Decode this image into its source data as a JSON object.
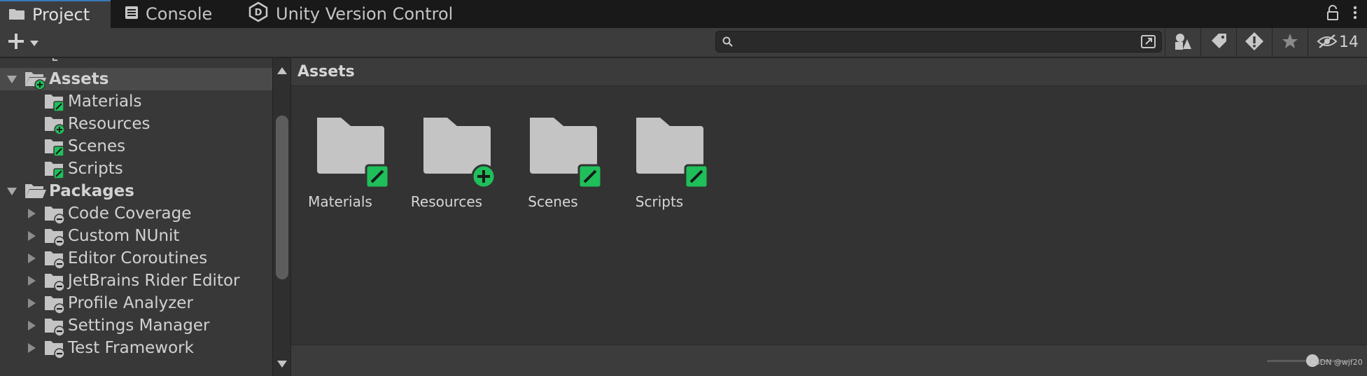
{
  "tabs": [
    {
      "label": "Project",
      "icon": "folder-icon",
      "active": true
    },
    {
      "label": "Console",
      "icon": "console-icon",
      "active": false
    },
    {
      "label": "Unity Version Control",
      "icon": "version-control-icon",
      "active": false
    }
  ],
  "toolbar": {
    "add_icon": "plus-icon",
    "search_placeholder": "",
    "hidden_packages_count": "14"
  },
  "tree": {
    "items": [
      {
        "label": "Assets",
        "level": 0,
        "expanded": true,
        "selected": true,
        "badge": "add"
      },
      {
        "label": "Materials",
        "level": 1,
        "badge": "edit"
      },
      {
        "label": "Resources",
        "level": 1,
        "badge": "add"
      },
      {
        "label": "Scenes",
        "level": 1,
        "badge": "edit"
      },
      {
        "label": "Scripts",
        "level": 1,
        "badge": "edit"
      },
      {
        "label": "Packages",
        "level": 0,
        "expanded": true,
        "badge": "none"
      },
      {
        "label": "Code Coverage",
        "level": 1,
        "collapsed": true,
        "badge": "minus"
      },
      {
        "label": "Custom NUnit",
        "level": 1,
        "collapsed": true,
        "badge": "minus"
      },
      {
        "label": "Editor Coroutines",
        "level": 1,
        "collapsed": true,
        "badge": "minus"
      },
      {
        "label": "JetBrains Rider Editor",
        "level": 1,
        "collapsed": true,
        "badge": "minus"
      },
      {
        "label": "Profile Analyzer",
        "level": 1,
        "collapsed": true,
        "badge": "minus"
      },
      {
        "label": "Settings Manager",
        "level": 1,
        "collapsed": true,
        "badge": "minus"
      },
      {
        "label": "Test Framework",
        "level": 1,
        "collapsed": true,
        "badge": "minus"
      }
    ]
  },
  "main": {
    "breadcrumb": "Assets",
    "items": [
      {
        "label": "Materials",
        "badge": "edit"
      },
      {
        "label": "Resources",
        "badge": "add"
      },
      {
        "label": "Scenes",
        "badge": "edit"
      },
      {
        "label": "Scripts",
        "badge": "edit"
      }
    ]
  },
  "footer": {
    "watermark": "CSDN @wjf20",
    "zoom_level": 0.55
  },
  "colors": {
    "badge_green": "#1fbf5a",
    "folder_gray": "#c4c4c4",
    "tab_accent": "#3a79bb"
  }
}
